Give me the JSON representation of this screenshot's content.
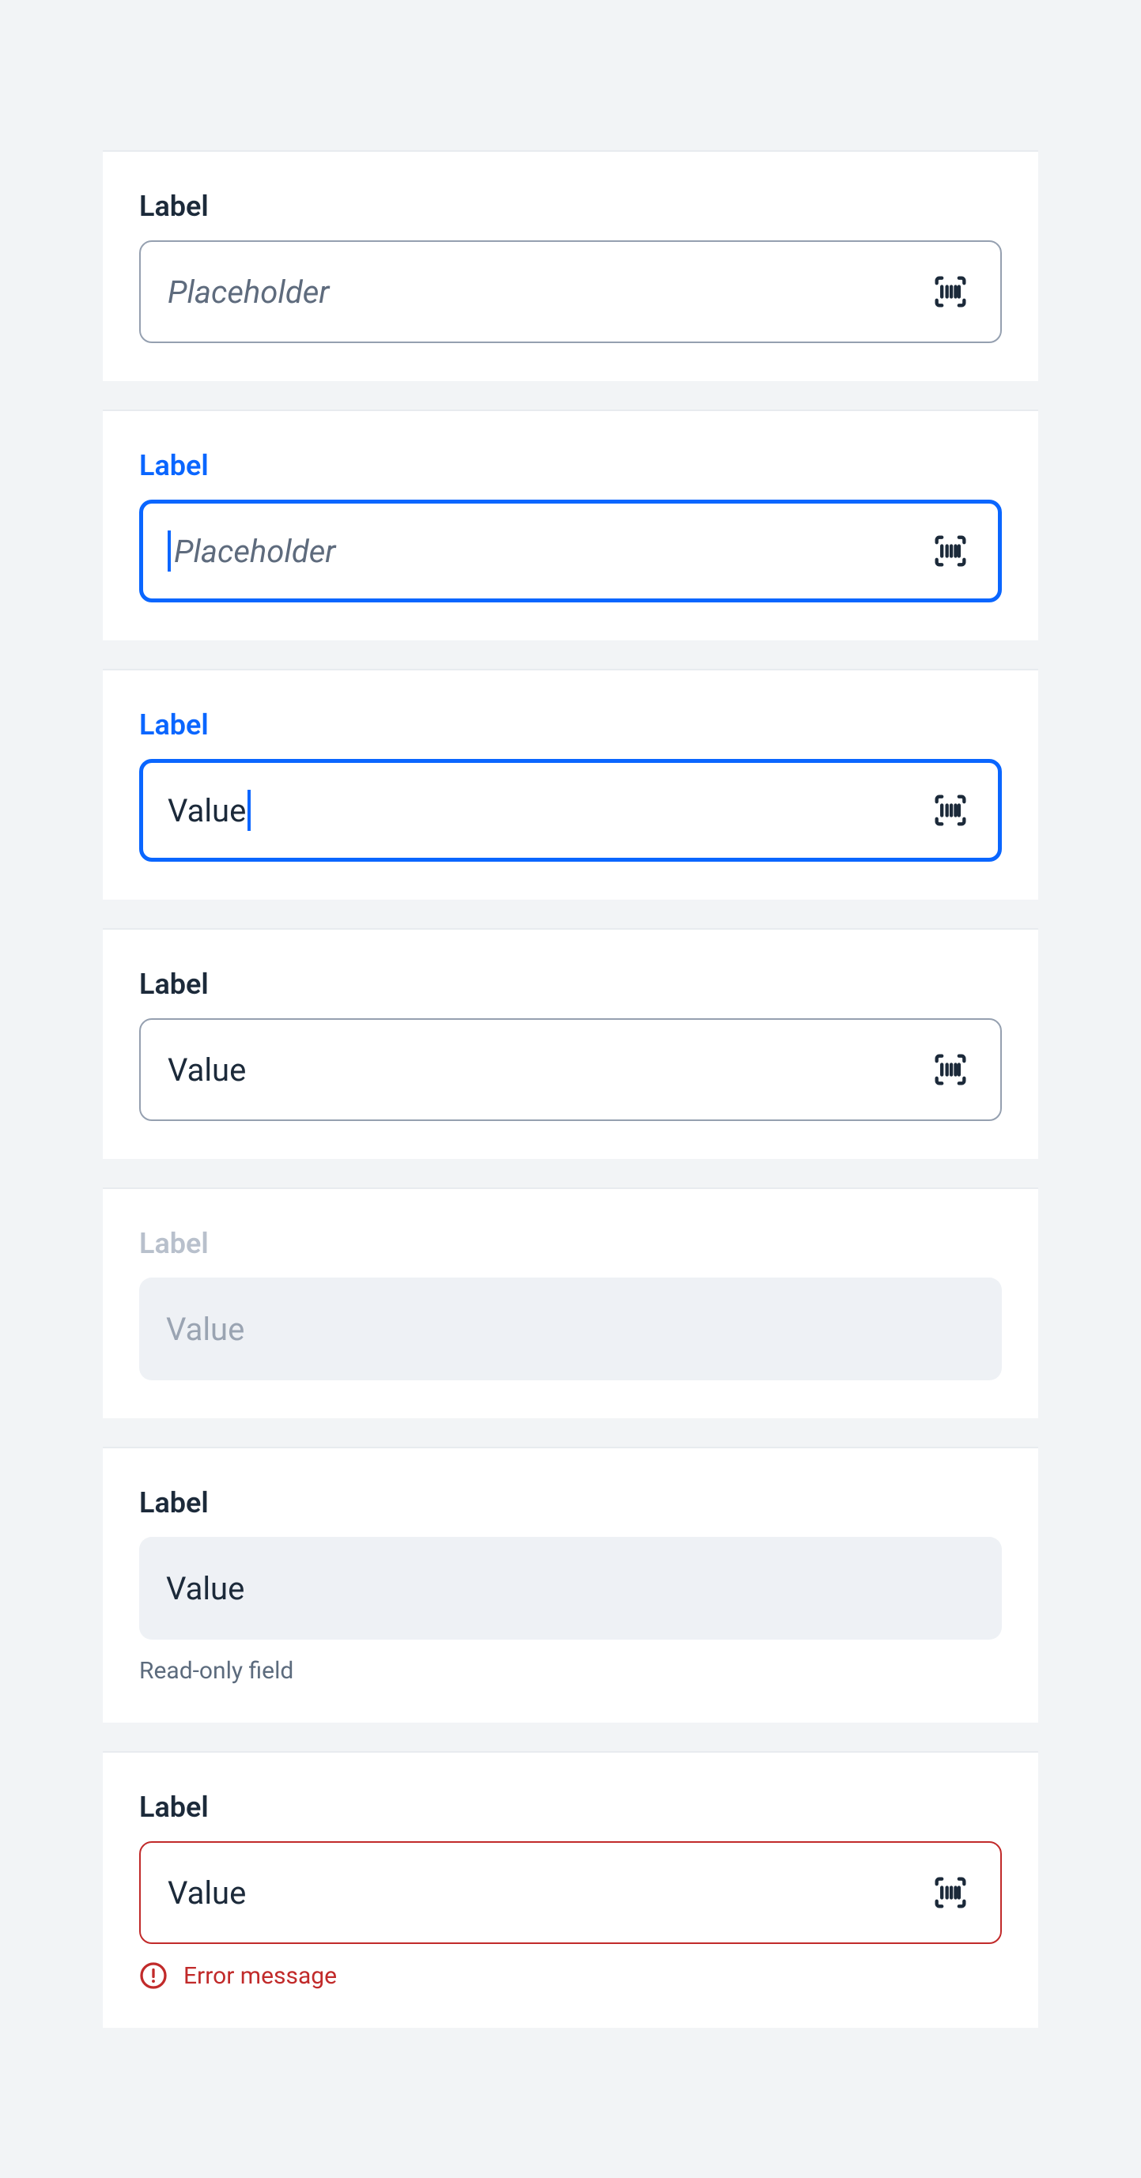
{
  "fields": [
    {
      "label": "Label",
      "placeholder": "Placeholder",
      "value": "",
      "helper": "",
      "error": ""
    },
    {
      "label": "Label",
      "placeholder": "Placeholder",
      "value": "",
      "helper": "",
      "error": ""
    },
    {
      "label": "Label",
      "placeholder": "",
      "value": "Value",
      "helper": "",
      "error": ""
    },
    {
      "label": "Label",
      "placeholder": "",
      "value": "Value",
      "helper": "",
      "error": ""
    },
    {
      "label": "Label",
      "placeholder": "",
      "value": "Value",
      "helper": "",
      "error": ""
    },
    {
      "label": "Label",
      "placeholder": "",
      "value": "Value",
      "helper": "Read-only field",
      "error": ""
    },
    {
      "label": "Label",
      "placeholder": "",
      "value": "Value",
      "helper": "",
      "error": "Error message"
    }
  ]
}
